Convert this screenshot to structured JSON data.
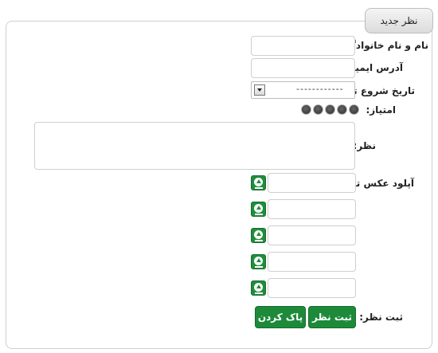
{
  "panel": {
    "tab_title": "نظر جدید"
  },
  "form": {
    "full_name_label": "نام و نام خانوادگی:",
    "email_label": "آدرس ایمیل:",
    "tour_date_label": "تاریخ شروع تور:",
    "tour_date_value": "------------",
    "rating_label": "امتیاز:",
    "rating_max": 5,
    "comment_label": "نظر:",
    "upload_label": "آپلود عکس تور:",
    "upload_slots": 5,
    "submit_row_label": "ثبت نظر:",
    "submit_button": "ثبت نظر",
    "clear_button": "پاک کردن"
  },
  "colors": {
    "accent": "#1d8a3a",
    "border": "#cfcfcf"
  },
  "icons": {
    "upload": "upload-arrow-icon",
    "dropdown": "chevron-down-icon",
    "rating": "circle-star-icon"
  }
}
